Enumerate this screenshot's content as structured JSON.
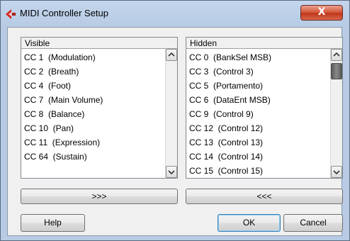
{
  "window": {
    "title": "MIDI Controller Setup",
    "close_label": "X",
    "accent_color": "#c1361a"
  },
  "visible_panel": {
    "header": "Visible",
    "items": [
      "CC 1  (Modulation)",
      "CC 2  (Breath)",
      "CC 4  (Foot)",
      "CC 7  (Main Volume)",
      "CC 8  (Balance)",
      "CC 10  (Pan)",
      "CC 11  (Expression)",
      "CC 64  (Sustain)"
    ]
  },
  "hidden_panel": {
    "header": "Hidden",
    "items": [
      "CC 0  (BankSel MSB)",
      "CC 3  (Control 3)",
      "CC 5  (Portamento)",
      "CC 6  (DataEnt MSB)",
      "CC 9  (Control 9)",
      "CC 12  (Control 12)",
      "CC 13  (Control 13)",
      "CC 14  (Control 14)",
      "CC 15  (Control 15)"
    ],
    "scroll_position": 0.0
  },
  "buttons": {
    "move_to_hidden": ">>>",
    "move_to_visible": "<<<",
    "help": "Help",
    "ok": "OK",
    "cancel": "Cancel"
  }
}
